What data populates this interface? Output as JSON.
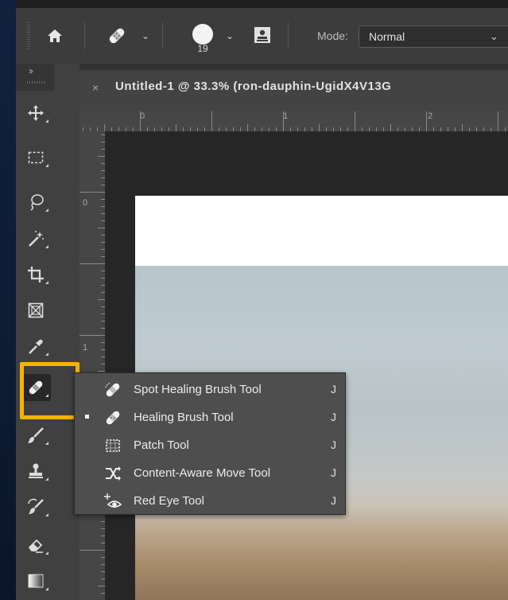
{
  "options_bar": {
    "icons": [
      "home-icon",
      "healing-brush-icon",
      "brush-preset-icon",
      "clone-source-icon"
    ],
    "brush_size": "19",
    "mode_label": "Mode:",
    "mode_value": "Normal"
  },
  "toolbar": {
    "collapse": "››",
    "tools": [
      "move-tool-icon",
      "marquee-tool-icon",
      "lasso-tool-icon",
      "magic-wand-icon",
      "crop-tool-icon",
      "frame-tool-icon",
      "eyedropper-icon",
      "healing-brush-icon",
      "brush-tool-icon",
      "clone-stamp-icon",
      "history-brush-icon",
      "eraser-icon",
      "gradient-icon"
    ],
    "highlight_color": "#f5b400"
  },
  "document": {
    "close": "×",
    "title": "Untitled-1 @ 33.3% (ron-dauphin-UgidX4V13G"
  },
  "rulers": {
    "top_labels": [
      "0",
      "1",
      "2"
    ],
    "left_labels": [
      "0",
      "1"
    ]
  },
  "flyout": {
    "selected_index": 1,
    "items": [
      {
        "label": "Spot Healing Brush Tool",
        "shortcut": "J",
        "icon": "spot-healing-brush-icon"
      },
      {
        "label": "Healing Brush Tool",
        "shortcut": "J",
        "icon": "healing-brush-icon"
      },
      {
        "label": "Patch Tool",
        "shortcut": "J",
        "icon": "patch-tool-icon"
      },
      {
        "label": "Content-Aware Move Tool",
        "shortcut": "J",
        "icon": "content-aware-move-icon"
      },
      {
        "label": "Red Eye Tool",
        "shortcut": "J",
        "icon": "red-eye-icon"
      }
    ]
  }
}
